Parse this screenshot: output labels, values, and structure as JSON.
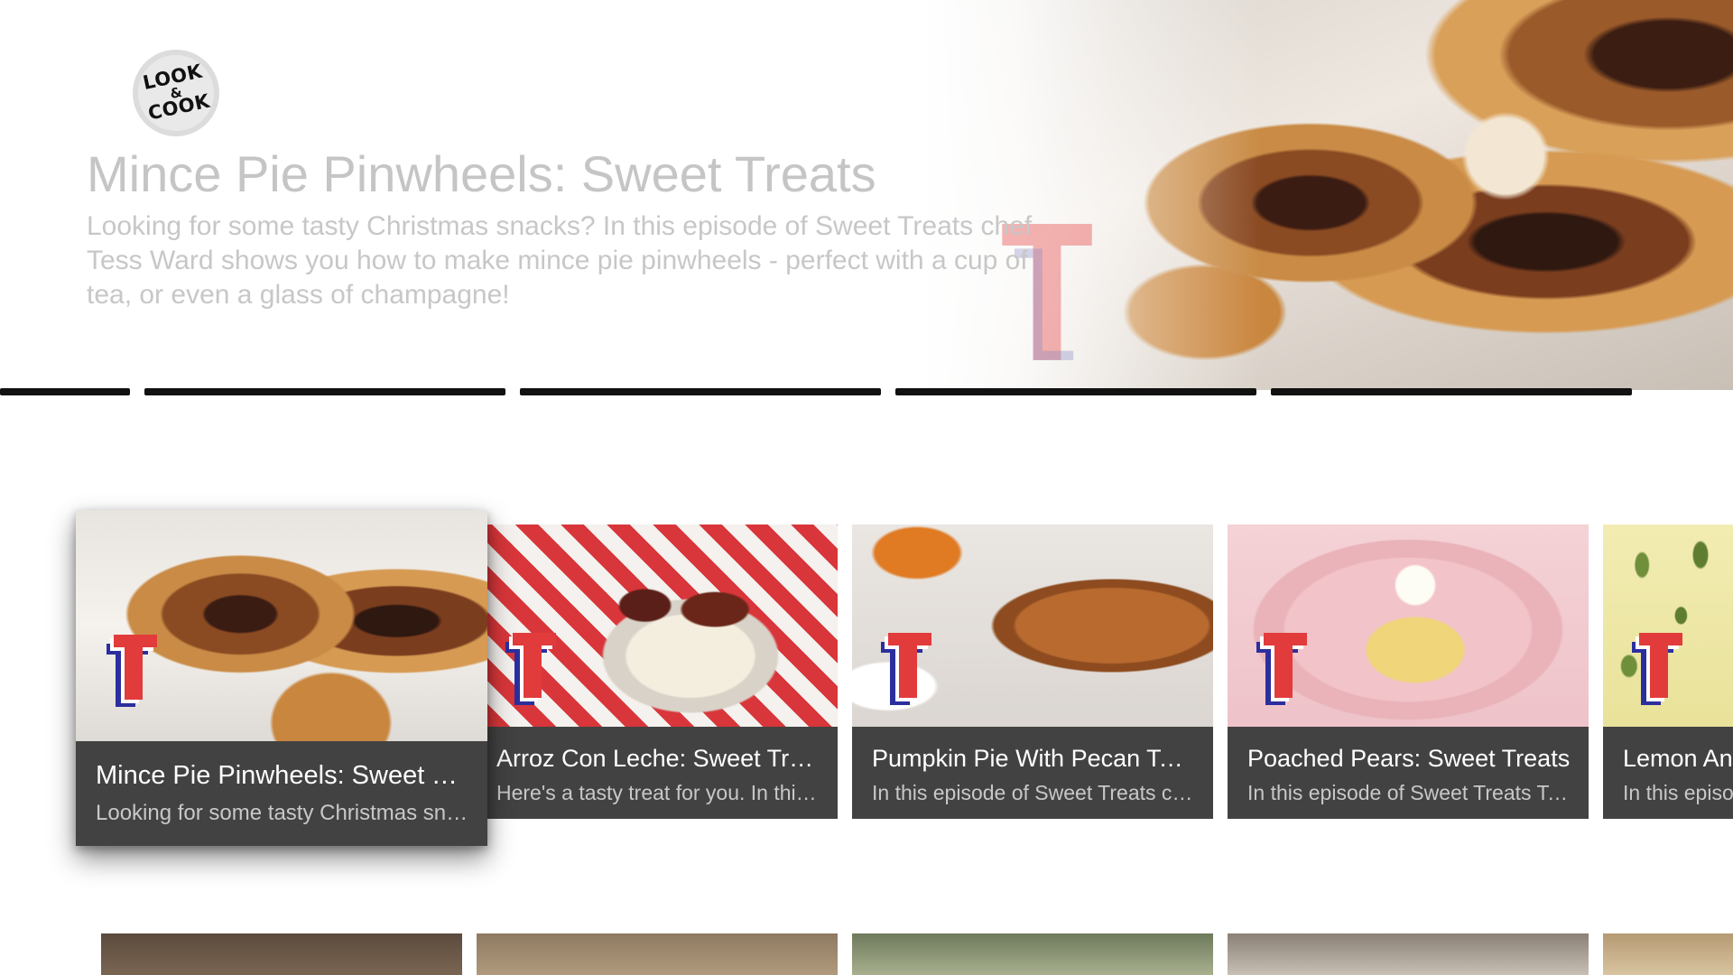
{
  "app": {
    "logo": {
      "line1": "LOOK",
      "amp": "&",
      "line2": "COOK"
    }
  },
  "hero": {
    "title": "Mince Pie Pinwheels: Sweet Treats",
    "description": "Looking for some tasty Christmas snacks? In this episode of Sweet Treats chef Tess Ward shows you how to make mince pie pinwheels - perfect with a cup of tea, or even a glass of champagne!",
    "image": "mince-pie-pinwheels-hero"
  },
  "row_tabs": {
    "count": 5
  },
  "cards": [
    {
      "title": "Mince Pie Pinwheels: Sweet Treats",
      "description": "Looking for some tasty Christmas snacks? In this episode of Sweet Treats",
      "focused": true
    },
    {
      "title": "Arroz Con Leche: Sweet Treats",
      "description": "Here's a tasty treat for you. In this episode"
    },
    {
      "title": "Pumpkin Pie With Pecan Topping: Sweet Treats",
      "description": "In this episode of Sweet Treats chef Tess Ward"
    },
    {
      "title": "Poached Pears: Sweet Treats",
      "description": "In this episode of Sweet Treats Tess Ward"
    },
    {
      "title": "Lemon And",
      "description": "In this episo"
    }
  ],
  "colors": {
    "card_background": "#424242",
    "card_title": "#ffffff",
    "card_description": "#c8c8c8",
    "tab_indicator": "#111111",
    "hero_text": "#c5c5c5",
    "brand_red": "#e23b3b",
    "brand_blue": "#2b2f9e"
  },
  "icons": {
    "logo": "look-and-cook-logo",
    "card_badge": "sweet-treats-t-badge"
  }
}
